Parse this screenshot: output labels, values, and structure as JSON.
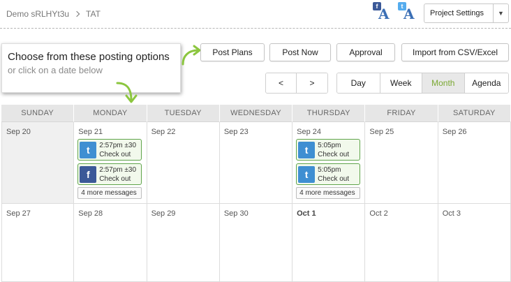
{
  "breadcrumb": {
    "account": "Demo sRLHYt3u",
    "page": "TAT"
  },
  "accounts": [
    {
      "network": "facebook",
      "net_glyph": "f",
      "badge": "A"
    },
    {
      "network": "twitter",
      "net_glyph": "t",
      "badge": "A"
    }
  ],
  "project_settings": {
    "label": "Project Settings",
    "caret": "▼"
  },
  "callout": {
    "title": "Choose from these posting options",
    "subtitle": "or click on a date below"
  },
  "toolbar": {
    "post_plans": "Post Plans",
    "post_now": "Post Now",
    "approval": "Approval",
    "import_csv": "Import from CSV/Excel"
  },
  "nav": {
    "prev": "<",
    "next": ">"
  },
  "views": {
    "day": "Day",
    "week": "Week",
    "month": "Month",
    "agenda": "Agenda",
    "active": "Month"
  },
  "calendar": {
    "headers": [
      "SUNDAY",
      "MONDAY",
      "TUESDAY",
      "WEDNESDAY",
      "THURSDAY",
      "FRIDAY",
      "SATURDAY"
    ],
    "week1": [
      "Sep 20",
      "Sep 21",
      "Sep 22",
      "Sep 23",
      "Sep 24",
      "Sep 25",
      "Sep 26"
    ],
    "week2": [
      "Sep 27",
      "Sep 28",
      "Sep 29",
      "Sep 30",
      "Oct 1",
      "Oct 2",
      "Oct 3"
    ],
    "monday_messages": [
      {
        "network": "twitter",
        "glyph": "t",
        "time": "2:57pm ±30",
        "text": "Check out"
      },
      {
        "network": "facebook",
        "glyph": "f",
        "time": "2:57pm ±30",
        "text": "Check out"
      }
    ],
    "monday_more": "4 more messages",
    "thursday_messages": [
      {
        "network": "twitter",
        "glyph": "t",
        "time": "5:05pm",
        "text": "Check out"
      },
      {
        "network": "twitter",
        "glyph": "t",
        "time": "5:05pm",
        "text": "Check out"
      }
    ],
    "thursday_more": "4 more messages"
  },
  "colors": {
    "accent_green": "#7aa832",
    "message_border": "#5fa44a",
    "twitter": "#3f8fd2",
    "facebook": "#3b5998"
  }
}
